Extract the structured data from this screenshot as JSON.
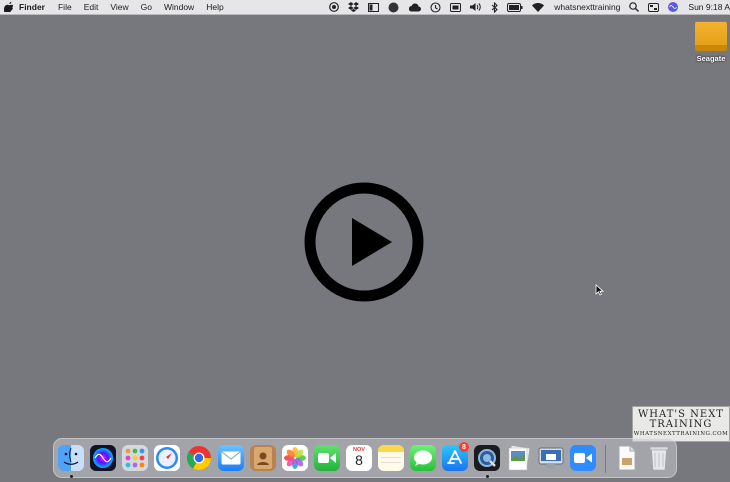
{
  "menubar": {
    "app_name": "Finder",
    "menus": [
      "File",
      "Edit",
      "View",
      "Go",
      "Window",
      "Help"
    ],
    "status_icons": [
      "record-icon",
      "dropbox-icon",
      "window-icon",
      "dark-circle-icon",
      "cloud-icon",
      "time-machine-icon",
      "display-icon",
      "volume-icon",
      "bluetooth-icon",
      "battery-icon",
      "wifi-icon"
    ],
    "user_name": "whatsnexttraining",
    "clock": "Sun 9:18 A",
    "right_icons": [
      "spotlight-icon",
      "control-icon",
      "siri-icon"
    ]
  },
  "desktop": {
    "drive_label": "Seagate"
  },
  "watermark": {
    "line1": "WHAT'S NEXT",
    "line2": "TRAINING",
    "url": "WHATSNEXTTRAINING.COM"
  },
  "dock": {
    "apps": [
      "Finder",
      "Siri",
      "Launchpad",
      "Safari",
      "Chrome",
      "Mail",
      "Contacts",
      "Photos",
      "FaceTime",
      "Calendar",
      "Notes",
      "Messages",
      "App Store",
      "QuickTime Player",
      "Preview",
      "Screen Sharing",
      "Zoom",
      "Document",
      "Trash"
    ],
    "calendar_month": "NOV",
    "calendar_day": "8",
    "appstore_badge": "8"
  }
}
